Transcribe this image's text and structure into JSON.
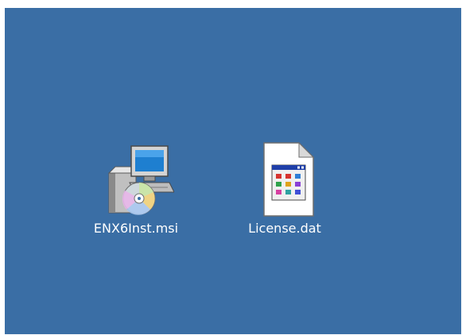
{
  "desktop": {
    "background": "#3a6ea5",
    "icons": [
      {
        "label": "ENX6Inst.msi",
        "icon": "windows-installer-package-icon"
      },
      {
        "label": "License.dat",
        "icon": "generic-data-file-icon"
      }
    ]
  }
}
